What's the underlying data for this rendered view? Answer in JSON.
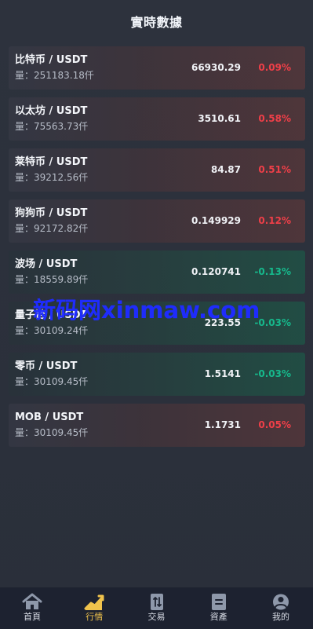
{
  "header": {
    "title": "實時數據"
  },
  "markets": [
    {
      "pair": "比特币 / USDT",
      "volume": "量：251183.18仟",
      "price": "66930.29",
      "change": "0.09%",
      "trend": "down"
    },
    {
      "pair": "以太坊 / USDT",
      "volume": "量：75563.73仟",
      "price": "3510.61",
      "change": "0.58%",
      "trend": "down"
    },
    {
      "pair": "莱特币 / USDT",
      "volume": "量：39212.56仟",
      "price": "84.87",
      "change": "0.51%",
      "trend": "down"
    },
    {
      "pair": "狗狗币 / USDT",
      "volume": "量：92172.82仟",
      "price": "0.149929",
      "change": "0.12%",
      "trend": "down"
    },
    {
      "pair": "波场 / USDT",
      "volume": "量：18559.89仟",
      "price": "0.120741",
      "change": "-0.13%",
      "trend": "up"
    },
    {
      "pair": "量子链 / USDT",
      "volume": "量：30109.24仟",
      "price": "223.55",
      "change": "-0.03%",
      "trend": "up"
    },
    {
      "pair": "零币 / USDT",
      "volume": "量：30109.45仟",
      "price": "1.5141",
      "change": "-0.03%",
      "trend": "up"
    },
    {
      "pair": "MOB / USDT",
      "volume": "量：30109.45仟",
      "price": "1.1731",
      "change": "0.05%",
      "trend": "down"
    }
  ],
  "watermark": {
    "text": "新码网xinmaw.com"
  },
  "bottom_nav": {
    "items": [
      {
        "label": "首頁",
        "icon": "home-icon",
        "active": false
      },
      {
        "label": "行情",
        "icon": "market-chart-icon",
        "active": true
      },
      {
        "label": "交易",
        "icon": "trade-icon",
        "active": false
      },
      {
        "label": "資產",
        "icon": "assets-icon",
        "active": false
      },
      {
        "label": "我的",
        "icon": "profile-icon",
        "active": false
      }
    ]
  },
  "colors": {
    "rise": "#ef3f48",
    "fall": "#16b98c",
    "active_tab": "#f0c34c"
  }
}
